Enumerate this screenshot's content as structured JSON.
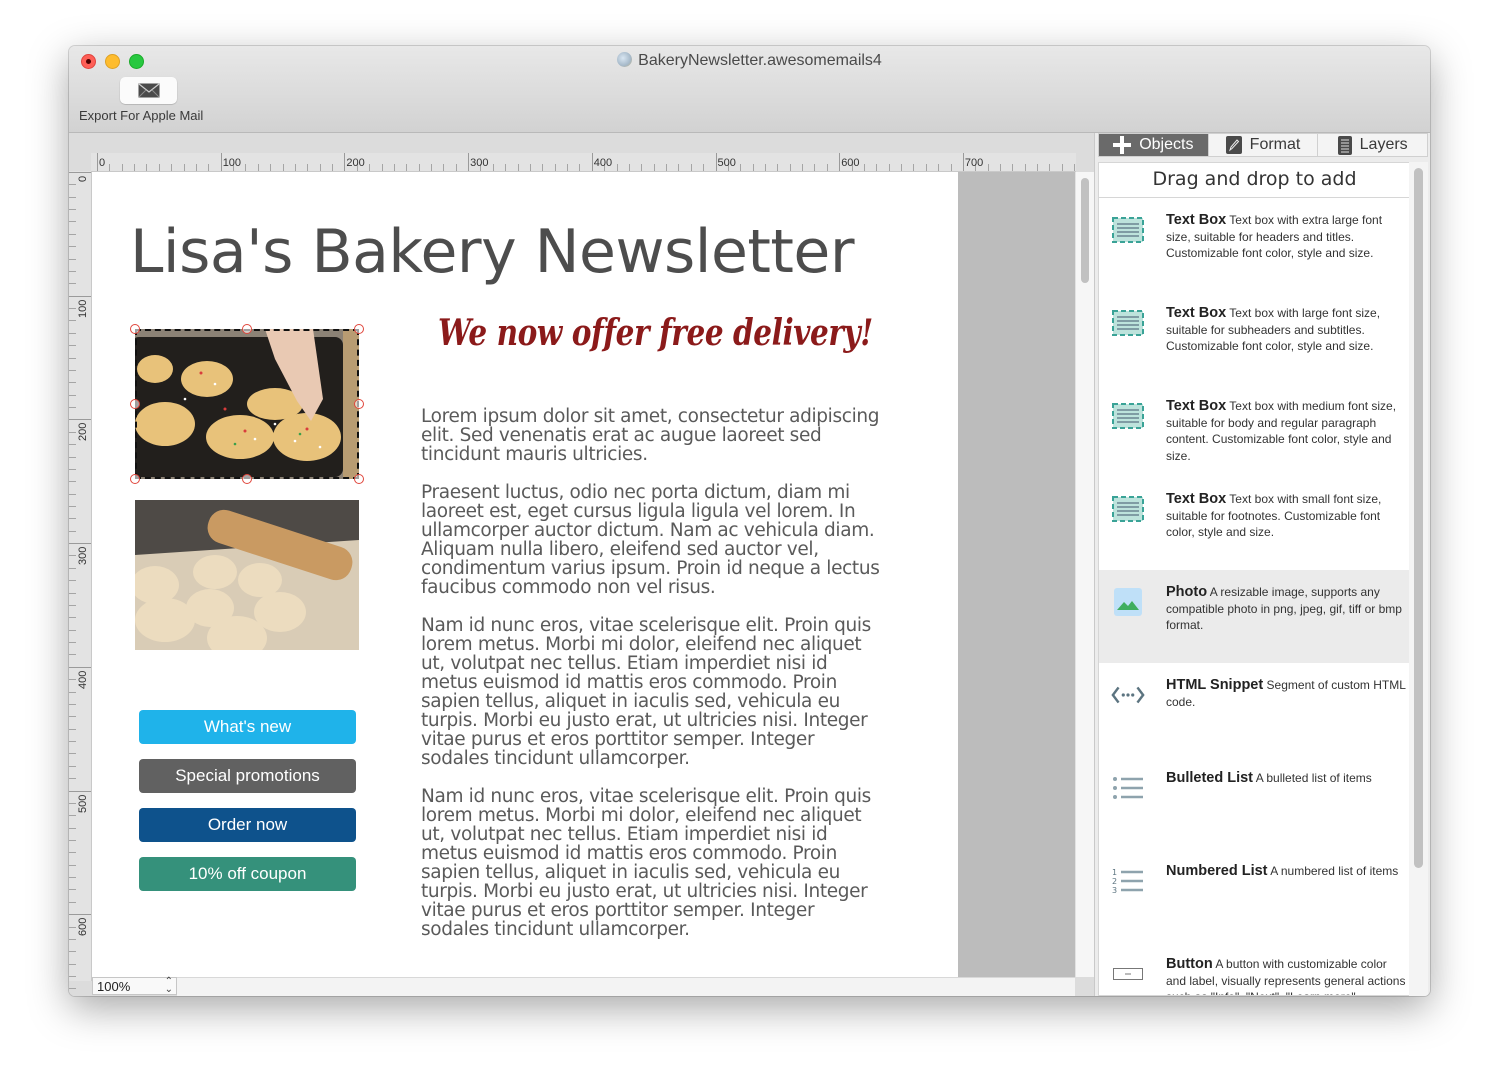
{
  "window": {
    "title": "BakeryNewsletter.awesomemails4",
    "toolbar": {
      "export_label": "Export For Apple Mail",
      "export_icon": "envelope-icon"
    }
  },
  "editor": {
    "hruler_labels": [
      "0",
      "100",
      "200",
      "300",
      "400",
      "500",
      "600",
      "700"
    ],
    "vruler_labels": [
      "0",
      "100",
      "200",
      "300",
      "400",
      "500",
      "600"
    ],
    "zoom_level": "100%"
  },
  "newsletter": {
    "title": "Lisa's Bakery Newsletter",
    "subtitle": "We now offer free delivery!",
    "title_color": "#4d4d4d",
    "subtitle_color": "#8b1a1a",
    "photos": [
      {
        "subject": "gingerbread cookies with sprinkles on baking tray",
        "selected": true
      },
      {
        "subject": "dough balls with rolling pin",
        "selected": false
      }
    ],
    "paragraphs": [
      "Lorem ipsum dolor sit amet, consectetur adipiscing elit. Sed venenatis erat ac augue laoreet sed tincidunt mauris ultricies.",
      "Praesent luctus, odio nec porta dictum, diam mi laoreet est, eget cursus ligula ligula vel lorem. In ullamcorper auctor dictum. Nam ac vehicula diam. Aliquam nulla libero, eleifend sed auctor vel, condimentum varius ipsum. Proin id neque a lectus faucibus commodo non vel risus.",
      "Nam id nunc eros, vitae scelerisque elit. Proin quis lorem metus. Morbi mi dolor, eleifend nec aliquet ut, volutpat nec tellus. Etiam imperdiet nisi id metus euismod id mattis eros commodo. Proin sapien tellus, aliquet in iaculis sed, vehicula eu turpis. Morbi eu justo erat, ut ultricies nisi. Integer vitae purus et eros porttitor semper. Integer sodales tincidunt ullamcorper.",
      "Nam id nunc eros, vitae scelerisque elit. Proin quis lorem metus. Morbi mi dolor, eleifend nec aliquet ut, volutpat nec tellus. Etiam imperdiet nisi id metus euismod id mattis eros commodo. Proin sapien tellus, aliquet in iaculis sed, vehicula eu turpis. Morbi eu justo erat, ut ultricies nisi. Integer vitae purus et eros porttitor semper. Integer sodales tincidunt ullamcorper."
    ],
    "buttons": [
      {
        "label": "What's new",
        "color": "#1fb3ea"
      },
      {
        "label": "Special promotions",
        "color": "#616161"
      },
      {
        "label": "Order now",
        "color": "#0e528c"
      },
      {
        "label": "10% off coupon",
        "color": "#35917b"
      }
    ]
  },
  "sidebar": {
    "tabs": [
      {
        "label": "Objects",
        "icon": "plus-icon",
        "active": true
      },
      {
        "label": "Format",
        "icon": "pencil-icon",
        "active": false
      },
      {
        "label": "Layers",
        "icon": "layers-list-icon",
        "active": false
      }
    ],
    "panel_heading": "Drag and drop to add",
    "objects": [
      {
        "name": "Text Box",
        "desc": "Text box with extra large font size, suitable for headers and titles. Customizable font color, style and size.",
        "icon": "text-box-icon"
      },
      {
        "name": "Text Box",
        "desc": "Text box with large font size, suitable for subheaders and subtitles. Customizable font color, style and size.",
        "icon": "text-box-icon"
      },
      {
        "name": "Text Box",
        "desc": "Text box with medium font size, suitable for body and regular paragraph content. Customizable font color, style and size.",
        "icon": "text-box-icon"
      },
      {
        "name": "Text Box",
        "desc": "Text box with small font size, suitable for footnotes. Customizable font color, style and size.",
        "icon": "text-box-icon"
      },
      {
        "name": "Photo",
        "desc": "A resizable image, supports any compatible photo in png, jpeg, gif, tiff or bmp format.",
        "icon": "photo-icon",
        "highlighted": true
      },
      {
        "name": "HTML Snippet",
        "desc": "Segment of custom HTML code.",
        "icon": "code-snippet-icon"
      },
      {
        "name": "Bulleted List",
        "desc": "A bulleted list of items",
        "icon": "bulleted-list-icon"
      },
      {
        "name": "Numbered List",
        "desc": "A numbered list of items",
        "icon": "numbered-list-icon"
      },
      {
        "name": "Button",
        "desc": "A button with customizable color and label, visually represents general actions such as \"Info\", \"Next\", \"Learn more\"",
        "icon": "button-icon"
      }
    ]
  }
}
